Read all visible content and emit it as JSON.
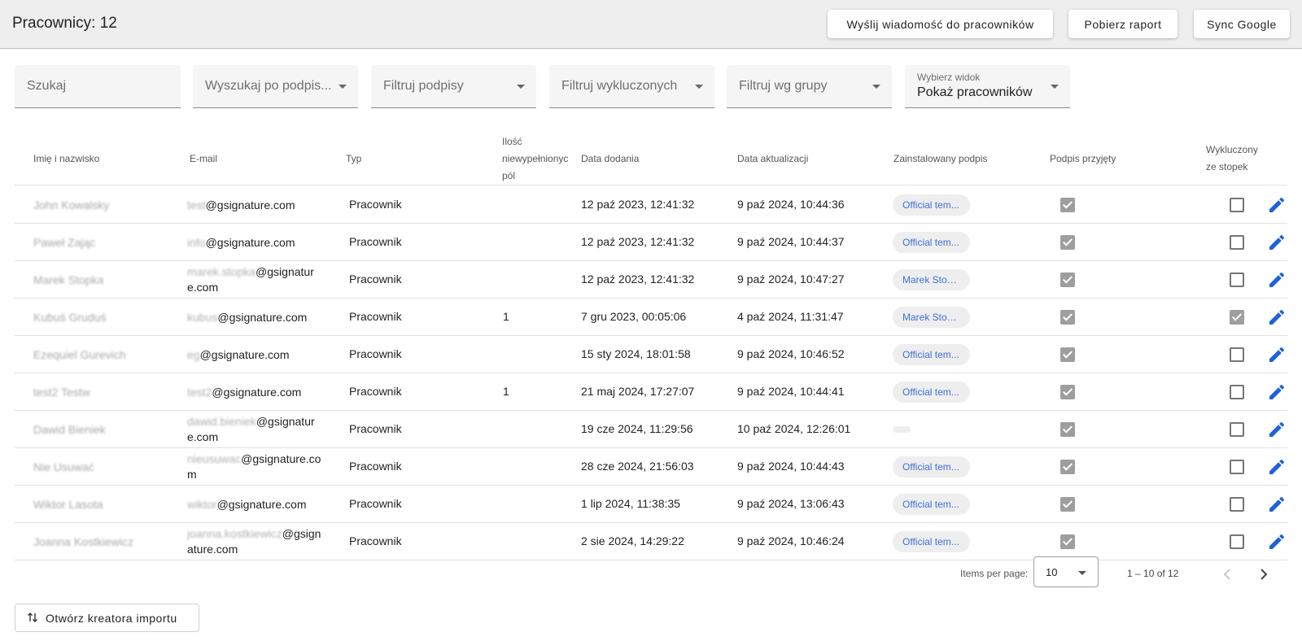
{
  "header": {
    "title": "Pracownicy: 12",
    "buttons": {
      "send_message": "Wyślij wiadomość do pracowników",
      "download_report": "Pobierz raport",
      "sync_google": "Sync Google"
    }
  },
  "filters": {
    "search": "Szukaj",
    "search_by_signature": "Wyszukaj po podpis...",
    "filter_signatures": "Filtruj podpisy",
    "filter_excluded": "Filtruj wykluczonych",
    "filter_group": "Filtruj wg grupy",
    "view_label": "Wybierz widok",
    "view_value": "Pokaż pracowników"
  },
  "table": {
    "headers": {
      "name": "Imię i nazwisko",
      "email": "E-mail",
      "type": "Typ",
      "missing_line1": "Ilość",
      "missing_line2": "niewypełnionyc",
      "missing_line3": "pól",
      "added": "Data dodania",
      "updated": "Data aktualizacji",
      "installed": "Zainstalowany podpis",
      "accepted": "Podpis przyjęty",
      "excluded_line1": "Wykluczony",
      "excluded_line2": "ze stopek"
    },
    "rows": [
      {
        "name": "John Kowalsky",
        "email_user": "test",
        "email_domain": "@gsignature.com",
        "type": "Pracownik",
        "missing": "",
        "added": "12 paź 2023, 12:41:32",
        "updated": "9 paź 2024, 10:44:36",
        "signature": "Official tem...",
        "accepted": true,
        "excluded": false
      },
      {
        "name": "Paweł Zając",
        "email_user": "info",
        "email_domain": "@gsignature.com",
        "type": "Pracownik",
        "missing": "",
        "added": "12 paź 2023, 12:41:32",
        "updated": "9 paź 2024, 10:44:37",
        "signature": "Official tem...",
        "accepted": true,
        "excluded": false
      },
      {
        "name": "Marek Stopka",
        "email_user": "marek.stopka",
        "email_domain": "@gsignature.com",
        "type": "Pracownik",
        "missing": "",
        "added": "12 paź 2023, 12:41:32",
        "updated": "9 paź 2024, 10:47:27",
        "signature": "Marek Stop...",
        "accepted": true,
        "excluded": false
      },
      {
        "name": "Kubuś Gruduś",
        "email_user": "kubus",
        "email_domain": "@gsignature.com",
        "type": "Pracownik",
        "missing": "1",
        "added": "7 gru 2023, 00:05:06",
        "updated": "4 paź 2024, 11:31:47",
        "signature": "Marek Stop...",
        "accepted": true,
        "excluded": true
      },
      {
        "name": "Ezequiel Gurevich",
        "email_user": "eg",
        "email_domain": "@gsignature.com",
        "type": "Pracownik",
        "missing": "",
        "added": "15 sty 2024, 18:01:58",
        "updated": "9 paź 2024, 10:46:52",
        "signature": "Official tem...",
        "accepted": true,
        "excluded": false
      },
      {
        "name": "test2 Testw",
        "email_user": "test2",
        "email_domain": "@gsignature.com",
        "type": "Pracownik",
        "missing": "1",
        "added": "21 maj 2024, 17:27:07",
        "updated": "9 paź 2024, 10:44:41",
        "signature": "Official tem...",
        "accepted": true,
        "excluded": false
      },
      {
        "name": "Dawid Bieniek",
        "email_user": "dawid.bieniek",
        "email_domain": "@gsignature.com",
        "type": "Pracownik",
        "missing": "",
        "added": "19 cze 2024, 11:29:56",
        "updated": "10 paź 2024, 12:26:01",
        "signature": "",
        "accepted": true,
        "excluded": false
      },
      {
        "name": "Nie Usuwać",
        "email_user": "nieusuwac",
        "email_domain": "@gsignature.com",
        "type": "Pracownik",
        "missing": "",
        "added": "28 cze 2024, 21:56:03",
        "updated": "9 paź 2024, 10:44:43",
        "signature": "Official tem...",
        "accepted": true,
        "excluded": false
      },
      {
        "name": "Wiktor Lasota",
        "email_user": "wiktor",
        "email_domain": "@gsignature.com",
        "type": "Pracownik",
        "missing": "",
        "added": "1 lip 2024, 11:38:35",
        "updated": "9 paź 2024, 13:06:43",
        "signature": "Official tem...",
        "accepted": true,
        "excluded": false
      },
      {
        "name": "Joanna Kostkiewicz",
        "email_user": "joanna.kostkiewicz",
        "email_domain": "@gsignature.com",
        "type": "Pracownik",
        "missing": "",
        "added": "2 sie 2024, 14:29:22",
        "updated": "9 paź 2024, 10:46:24",
        "signature": "Official tem...",
        "accepted": true,
        "excluded": false
      }
    ]
  },
  "paginator": {
    "items_per_page_label": "Items per page:",
    "items_per_page": "10",
    "range": "1 – 10 of 12"
  },
  "import_button": "Otwórz kreatora importu",
  "colors": {
    "accent": "#3f6fd8",
    "edit_icon": "#1e63d6",
    "checkbox_checked": "#9e9e9e"
  },
  "icons": {
    "edit": "pencil-icon",
    "prev": "chevron-left-icon",
    "next": "chevron-right-icon",
    "import": "swap-vertical-icon"
  }
}
